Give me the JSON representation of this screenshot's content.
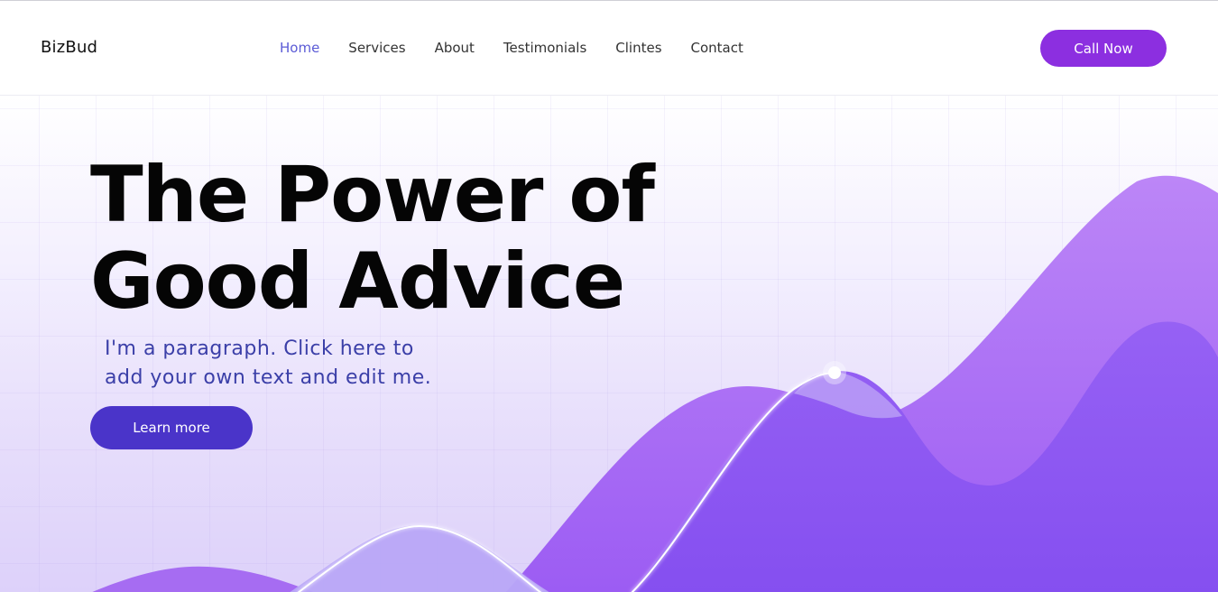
{
  "header": {
    "logo": "BizBud",
    "nav": [
      {
        "label": "Home",
        "active": true
      },
      {
        "label": "Services",
        "active": false
      },
      {
        "label": "About",
        "active": false
      },
      {
        "label": "Testimonials",
        "active": false
      },
      {
        "label": "Clintes",
        "active": false
      },
      {
        "label": "Contact",
        "active": false
      }
    ],
    "cta_label": "Call Now"
  },
  "hero": {
    "headline_line1": "The Power of",
    "headline_line2": "Good Advice",
    "paragraph_line1": "I'm a paragraph. Click here to",
    "paragraph_line2": "add your own text and edit me.",
    "button_label": "Learn more"
  },
  "colors": {
    "accent": "#8c2fe0",
    "active_nav": "#5b5bd6",
    "hero_button": "#4a34c9",
    "paragraph_text": "#3b3fa8",
    "wave_light": "#b07af5",
    "wave_dark": "#8a55f2"
  }
}
